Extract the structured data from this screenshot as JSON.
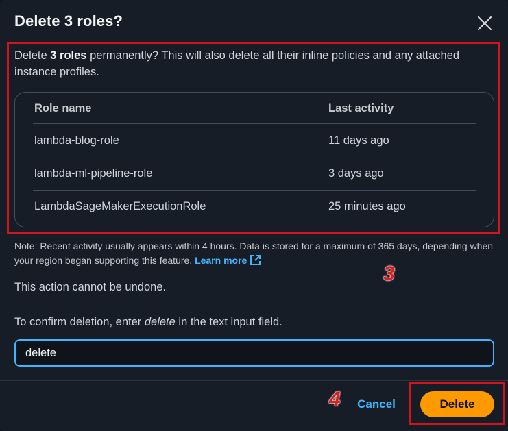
{
  "dialog": {
    "title": "Delete 3 roles?",
    "close_icon": "close-icon"
  },
  "intro": {
    "prefix": "Delete ",
    "count_bold": "3 roles",
    "suffix": " permanently? This will also delete all their inline policies and any attached instance profiles."
  },
  "table": {
    "columns": [
      "Role name",
      "Last activity"
    ],
    "rows": [
      {
        "role": "lambda-blog-role",
        "activity": "11 days ago"
      },
      {
        "role": "lambda-ml-pipeline-role",
        "activity": "3 days ago"
      },
      {
        "role": "LambdaSageMakerExecutionRole",
        "activity": "25 minutes ago"
      }
    ]
  },
  "note": {
    "text": "Note: Recent activity usually appears within 4 hours. Data is stored for a maximum of 365 days, depending when your region began supporting this feature.",
    "link": "Learn more",
    "link_icon": "external-link-icon"
  },
  "warning": "This action cannot be undone.",
  "confirm": {
    "prefix": "To confirm deletion, enter ",
    "keyword": "delete",
    "suffix": " in the text input field.",
    "value": "delete"
  },
  "footer": {
    "cancel_label": "Cancel",
    "delete_label": "Delete"
  },
  "annotations": [
    "3",
    "4"
  ],
  "colors": {
    "accent": "#42b4ff",
    "primary_button": "#ff9900",
    "annotation": "#d4141c"
  }
}
